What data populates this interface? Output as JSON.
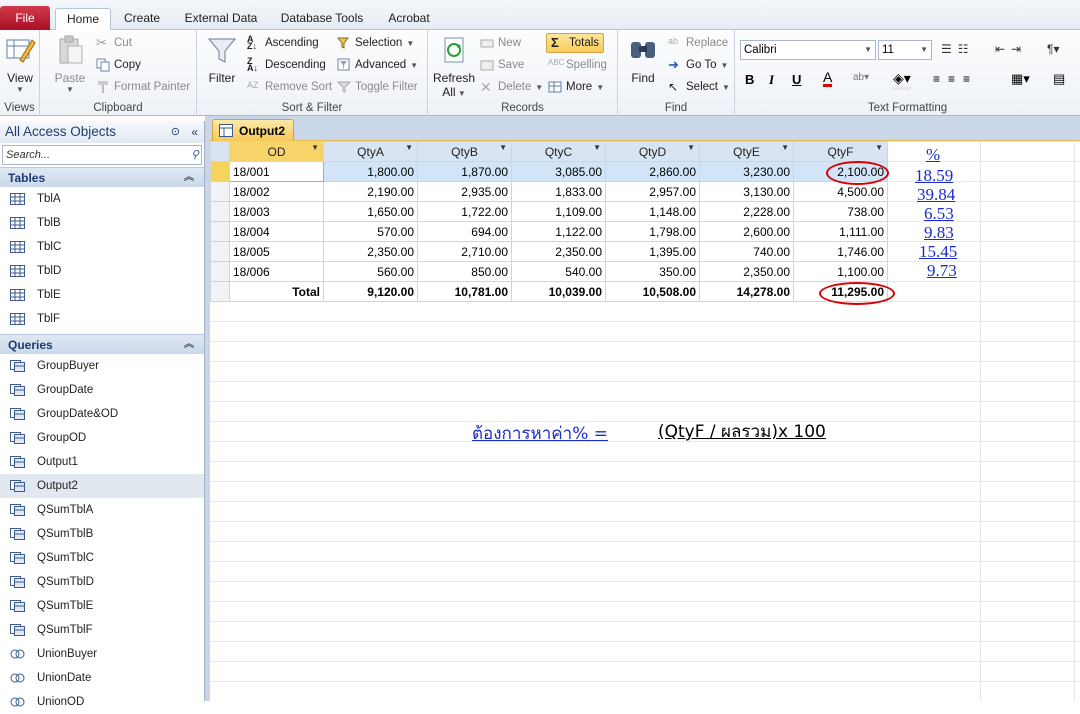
{
  "tabs": {
    "file": "File",
    "home": "Home",
    "create": "Create",
    "external": "External Data",
    "dbtools": "Database Tools",
    "acrobat": "Acrobat"
  },
  "ribbon": {
    "views": {
      "view": "View",
      "label": "Views"
    },
    "clipboard": {
      "paste": "Paste",
      "cut": "Cut",
      "copy": "Copy",
      "format_painter": "Format Painter",
      "label": "Clipboard"
    },
    "sort": {
      "filter": "Filter",
      "ascending": "Ascending",
      "descending": "Descending",
      "remove_sort": "Remove Sort",
      "selection": "Selection",
      "advanced": "Advanced",
      "toggle_filter": "Toggle Filter",
      "label": "Sort & Filter"
    },
    "records": {
      "refresh": "Refresh",
      "all": "All",
      "new": "New",
      "save": "Save",
      "delete": "Delete",
      "totals": "Totals",
      "spelling": "Spelling",
      "more": "More",
      "label": "Records"
    },
    "find": {
      "find": "Find",
      "replace": "Replace",
      "goto": "Go To",
      "select": "Select",
      "label": "Find"
    },
    "text": {
      "font": "Calibri",
      "size": "11",
      "label": "Text Formatting",
      "bold": "B",
      "italic": "I",
      "underline": "U",
      "font_color": "A"
    }
  },
  "nav": {
    "title": "All Access Objects",
    "search_placeholder": "Search...",
    "tables_header": "Tables",
    "tables": [
      "TblA",
      "TblB",
      "TblC",
      "TblD",
      "TblE",
      "TblF"
    ],
    "queries_header": "Queries",
    "queries": [
      "GroupBuyer",
      "GroupDate",
      "GroupDate&OD",
      "GroupOD",
      "Output1",
      "Output2",
      "QSumTblA",
      "QSumTblB",
      "QSumTblC",
      "QSumTblD",
      "QSumTblE",
      "QSumTblF",
      "UnionBuyer",
      "UnionDate",
      "UnionOD"
    ],
    "selected_query": "Output2"
  },
  "doc": {
    "tab": "Output2",
    "columns": [
      "OD",
      "QtyA",
      "QtyB",
      "QtyC",
      "QtyD",
      "QtyE",
      "QtyF"
    ],
    "rows": [
      [
        "18/001",
        "1,800.00",
        "1,870.00",
        "3,085.00",
        "2,860.00",
        "3,230.00",
        "2,100.00"
      ],
      [
        "18/002",
        "2,190.00",
        "2,935.00",
        "1,833.00",
        "2,957.00",
        "3,130.00",
        "4,500.00"
      ],
      [
        "18/003",
        "1,650.00",
        "1,722.00",
        "1,109.00",
        "1,148.00",
        "2,228.00",
        "738.00"
      ],
      [
        "18/004",
        "570.00",
        "694.00",
        "1,122.00",
        "1,798.00",
        "2,600.00",
        "1,111.00"
      ],
      [
        "18/005",
        "2,350.00",
        "2,710.00",
        "2,350.00",
        "1,395.00",
        "740.00",
        "1,746.00"
      ],
      [
        "18/006",
        "560.00",
        "850.00",
        "540.00",
        "350.00",
        "2,350.00",
        "1,100.00"
      ]
    ],
    "totals": [
      "Total",
      "9,120.00",
      "10,781.00",
      "10,039.00",
      "10,508.00",
      "14,278.00",
      "11,295.00"
    ]
  },
  "annotations": {
    "pct_header": "%",
    "pct_values": [
      "18.59",
      "39.84",
      "6.53",
      "9.83",
      "15.45",
      "9.73"
    ],
    "formula_label": "ต้องการหาค่า% =",
    "formula_expr": "(QtyF / ผลรวม)x 100",
    "ellipse_color": "#d90000",
    "link_color": "#1a2bcc"
  }
}
